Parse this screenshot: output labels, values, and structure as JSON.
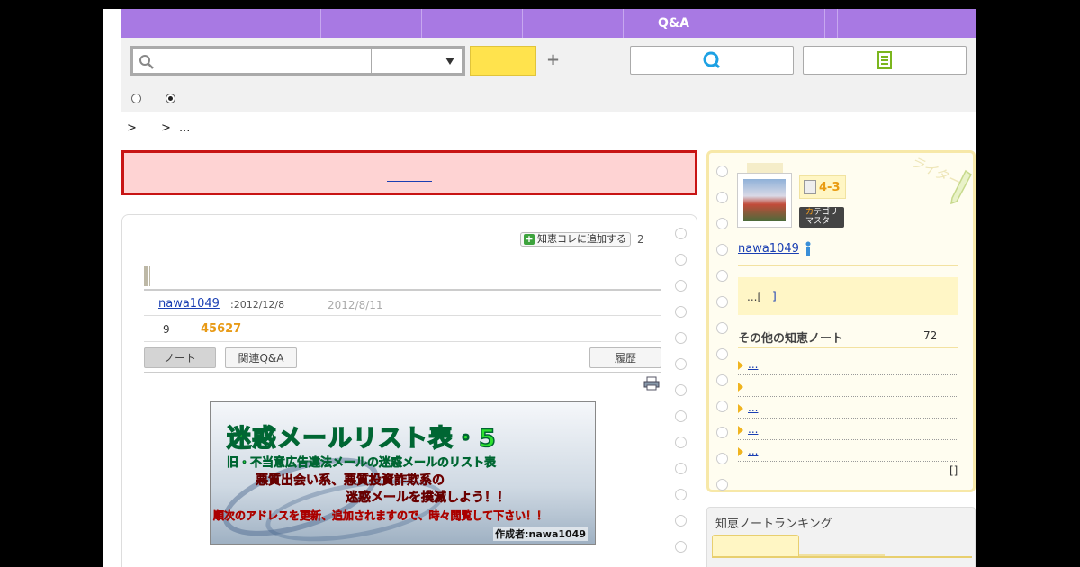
{
  "nav": {
    "items": [
      {
        "label": "",
        "width": 110
      },
      {
        "label": "",
        "width": 112
      },
      {
        "label": "",
        "width": 112
      },
      {
        "label": "",
        "width": 112
      },
      {
        "label": "",
        "width": 112
      },
      {
        "label": "Q&A",
        "width": 112
      },
      {
        "label": "",
        "width": 112
      },
      {
        "label": "",
        "width": 14
      },
      {
        "label": "",
        "width": 154
      }
    ]
  },
  "search": {
    "value": "",
    "placeholder": "",
    "select_value": "",
    "button_label": "",
    "ask_button_icon": "Q",
    "radio_options": [
      {
        "label": "",
        "selected": false
      },
      {
        "label": "",
        "selected": true
      }
    ]
  },
  "breadcrumb": {
    "sep1": ">",
    "sep2": ">",
    "current": "..."
  },
  "alert": {
    "text": "",
    "link_text": ""
  },
  "note": {
    "add_collection_label": "知恵コレに追加する",
    "add_count": "2",
    "title": "",
    "author": "nawa1049",
    "posted_date": ":2012/12/8",
    "updated_date": "2012/8/11",
    "useful_count": "9",
    "view_count": "45627",
    "tabs": {
      "note": "ノート",
      "related": "関連Q&A",
      "history": "履歴"
    },
    "banner": {
      "title": "迷惑メールリスト表・5",
      "line1": "旧・不当意広告違法メールの迷惑メールのリスト表",
      "line2": "悪質出会い系、悪質投資詐欺系の",
      "line3": "迷惑メールを撲滅しよう！！",
      "line4": "順次のアドレスを更新、追加されますので、時々閲覧して下さい！！",
      "credit": "作成者:nawa1049"
    }
  },
  "writer": {
    "deco": "ライター",
    "rank": "4-3",
    "master_badge_line1_kana": "カ",
    "master_badge_line1_rest": "テゴリ",
    "master_badge_line2": "マスター",
    "name": "nawa1049",
    "intro_text": "...[",
    "intro_link": "]",
    "other_notes_label": "その他の知恵ノート",
    "other_notes_count": "72",
    "other_notes": [
      "...",
      "",
      "...",
      "...",
      "..."
    ],
    "more_label": "[]"
  },
  "ranking": {
    "title": "知恵ノートランキング",
    "tab_active": "",
    "tab_second": ""
  },
  "colors": {
    "nav_bg": "#a879e3",
    "search_button": "#ffe34d",
    "alert_border": "#c81414",
    "alert_bg": "#fed3d3",
    "accent_orange": "#e89a16",
    "link_blue": "#1a3fb3",
    "writer_card_bg": "#fffdf0"
  }
}
